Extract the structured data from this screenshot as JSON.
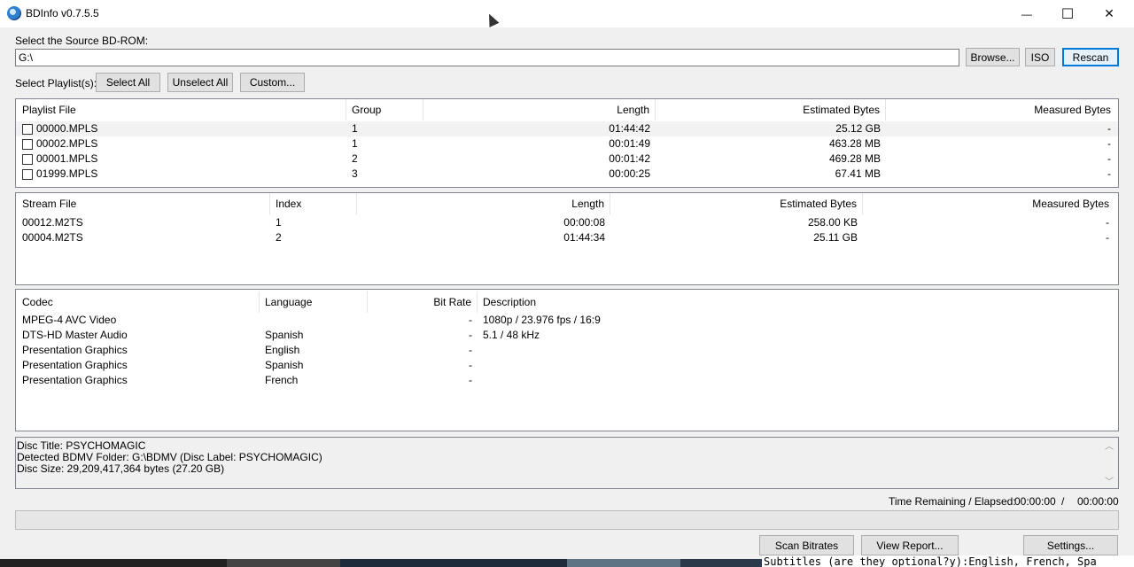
{
  "window": {
    "title": "BDInfo v0.7.5.5",
    "minimize_glyph": "—",
    "maximize_glyph": "☐",
    "close_glyph": "✕"
  },
  "source": {
    "label": "Select the Source BD-ROM:",
    "path": "G:\\",
    "browse_label": "Browse...",
    "iso_label": "ISO",
    "rescan_label": "Rescan"
  },
  "playlist_select": {
    "label": "Select Playlist(s):",
    "select_all_label": "Select All",
    "unselect_all_label": "Unselect All",
    "custom_label": "Custom..."
  },
  "playlists": {
    "columns": [
      "Playlist File",
      "Group",
      "Length",
      "Estimated Bytes",
      "Measured Bytes"
    ],
    "rows": [
      {
        "file": "00000.MPLS",
        "group": "1",
        "length": "01:44:42",
        "estimated": "25.12 GB",
        "measured": "-"
      },
      {
        "file": "00002.MPLS",
        "group": "1",
        "length": "00:01:49",
        "estimated": "463.28 MB",
        "measured": "-"
      },
      {
        "file": "00001.MPLS",
        "group": "2",
        "length": "00:01:42",
        "estimated": "469.28 MB",
        "measured": "-"
      },
      {
        "file": "01999.MPLS",
        "group": "3",
        "length": "00:00:25",
        "estimated": "67.41 MB",
        "measured": "-"
      }
    ]
  },
  "streams": {
    "columns": [
      "Stream File",
      "Index",
      "Length",
      "Estimated Bytes",
      "Measured Bytes"
    ],
    "rows": [
      {
        "file": "00012.M2TS",
        "index": "1",
        "length": "00:00:08",
        "estimated": "258.00 KB",
        "measured": "-"
      },
      {
        "file": "00004.M2TS",
        "index": "2",
        "length": "01:44:34",
        "estimated": "25.11 GB",
        "measured": "-"
      }
    ]
  },
  "codecs": {
    "columns": [
      "Codec",
      "Language",
      "Bit Rate",
      "Description"
    ],
    "rows": [
      {
        "codec": "MPEG-4 AVC Video",
        "language": "",
        "bitrate": "-",
        "description": "1080p / 23.976 fps / 16:9"
      },
      {
        "codec": "DTS-HD Master Audio",
        "language": "Spanish",
        "bitrate": "-",
        "description": "5.1 / 48 kHz"
      },
      {
        "codec": "Presentation Graphics",
        "language": "English",
        "bitrate": "-",
        "description": ""
      },
      {
        "codec": "Presentation Graphics",
        "language": "Spanish",
        "bitrate": "-",
        "description": ""
      },
      {
        "codec": "Presentation Graphics",
        "language": "French",
        "bitrate": "-",
        "description": ""
      }
    ]
  },
  "log": {
    "lines": [
      "Disc Title: PSYCHOMAGIC",
      "Detected BDMV Folder: G:\\BDMV (Disc Label: PSYCHOMAGIC)",
      "Disc Size: 29,209,417,364 bytes (27.20 GB)"
    ],
    "scroll_up_glyph": "︿",
    "scroll_down_glyph": "﹀"
  },
  "time": {
    "label": "Time Remaining / Elapsed:",
    "remaining": "00:00:00",
    "separator": "/",
    "elapsed": "00:00:00"
  },
  "progress": 0,
  "actions": {
    "scan_bitrates_label": "Scan Bitrates",
    "view_report_label": "View Report...",
    "settings_label": "Settings..."
  },
  "background_text": "Subtitles (are they optional?y):English, French, Spa"
}
